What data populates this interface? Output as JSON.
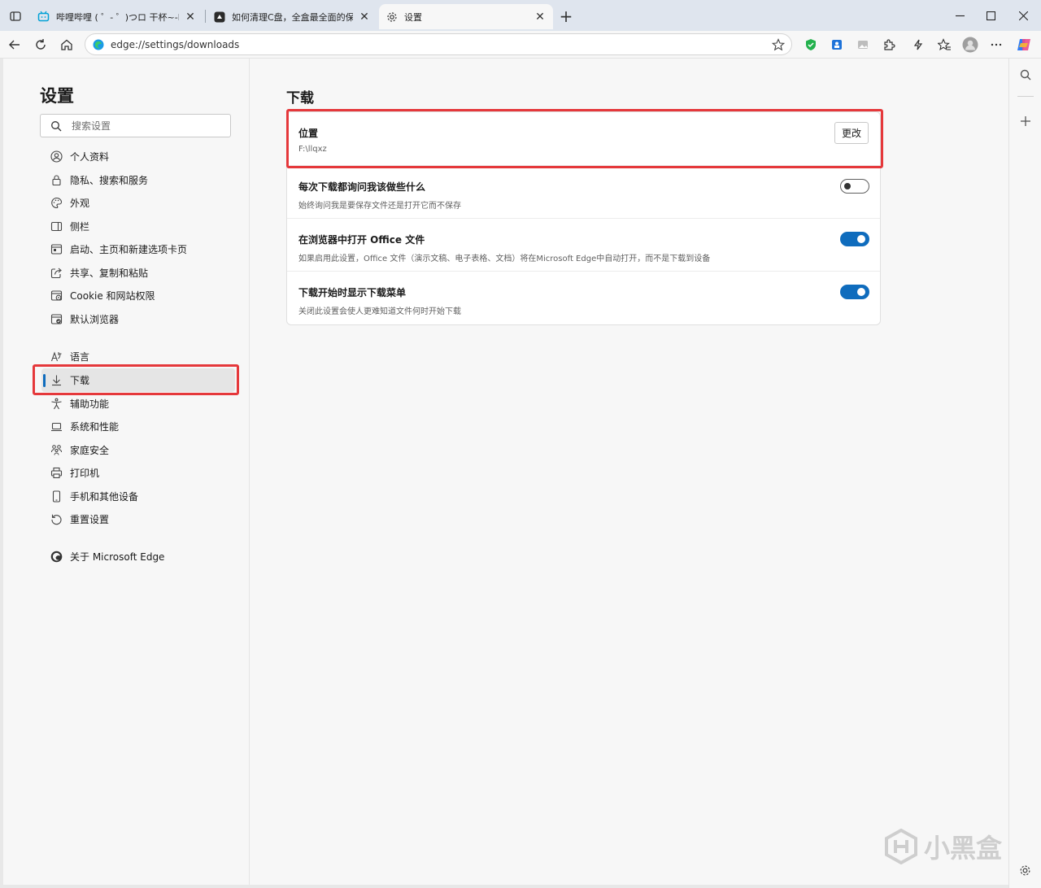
{
  "browser": {
    "tabs": [
      {
        "title": "哔哩哔哩 ( ゜- ゜)つロ 干杯~-bilibi",
        "active": false
      },
      {
        "title": "如何清理C盘，全盒最全面的保姆",
        "active": false
      },
      {
        "title": "设置",
        "active": true
      }
    ],
    "address": "edge://settings/downloads"
  },
  "sidebar": {
    "title": "设置",
    "search_placeholder": "搜索设置",
    "items": [
      {
        "label": "个人资料",
        "icon": "profile-icon"
      },
      {
        "label": "隐私、搜索和服务",
        "icon": "lock-icon"
      },
      {
        "label": "外观",
        "icon": "palette-icon"
      },
      {
        "label": "侧栏",
        "icon": "sidebar-icon"
      },
      {
        "label": "启动、主页和新建选项卡页",
        "icon": "home-tab-icon"
      },
      {
        "label": "共享、复制和粘贴",
        "icon": "share-icon"
      },
      {
        "label": "Cookie 和网站权限",
        "icon": "cookie-icon"
      },
      {
        "label": "默认浏览器",
        "icon": "browser-icon"
      },
      {
        "label": "语言",
        "icon": "language-icon"
      },
      {
        "label": "下载",
        "icon": "download-icon",
        "active": true
      },
      {
        "label": "辅助功能",
        "icon": "accessibility-icon"
      },
      {
        "label": "系统和性能",
        "icon": "laptop-icon"
      },
      {
        "label": "家庭安全",
        "icon": "family-icon"
      },
      {
        "label": "打印机",
        "icon": "printer-icon"
      },
      {
        "label": "手机和其他设备",
        "icon": "phone-icon"
      },
      {
        "label": "重置设置",
        "icon": "reset-icon"
      },
      {
        "label": "关于 Microsoft Edge",
        "icon": "edge-logo-icon"
      }
    ]
  },
  "main": {
    "title": "下载",
    "rows": [
      {
        "title": "位置",
        "desc": "F:\\llqxz",
        "control": "button",
        "button_label": "更改"
      },
      {
        "title": "每次下载都询问我该做些什么",
        "desc": "始终询问我是要保存文件还是打开它而不保存",
        "control": "toggle",
        "on": false
      },
      {
        "title": "在浏览器中打开 Office 文件",
        "desc": "如果启用此设置，Office 文件（演示文稿、电子表格、文档）将在Microsoft Edge中自动打开，而不是下载到设备",
        "control": "toggle",
        "on": true
      },
      {
        "title": "下载开始时显示下载菜单",
        "desc": "关闭此设置会使人更难知道文件何时开始下载",
        "control": "toggle",
        "on": true
      }
    ]
  },
  "watermark": "小黑盒",
  "colors": {
    "accent": "#0f6cbd",
    "highlight": "#e5383b"
  }
}
